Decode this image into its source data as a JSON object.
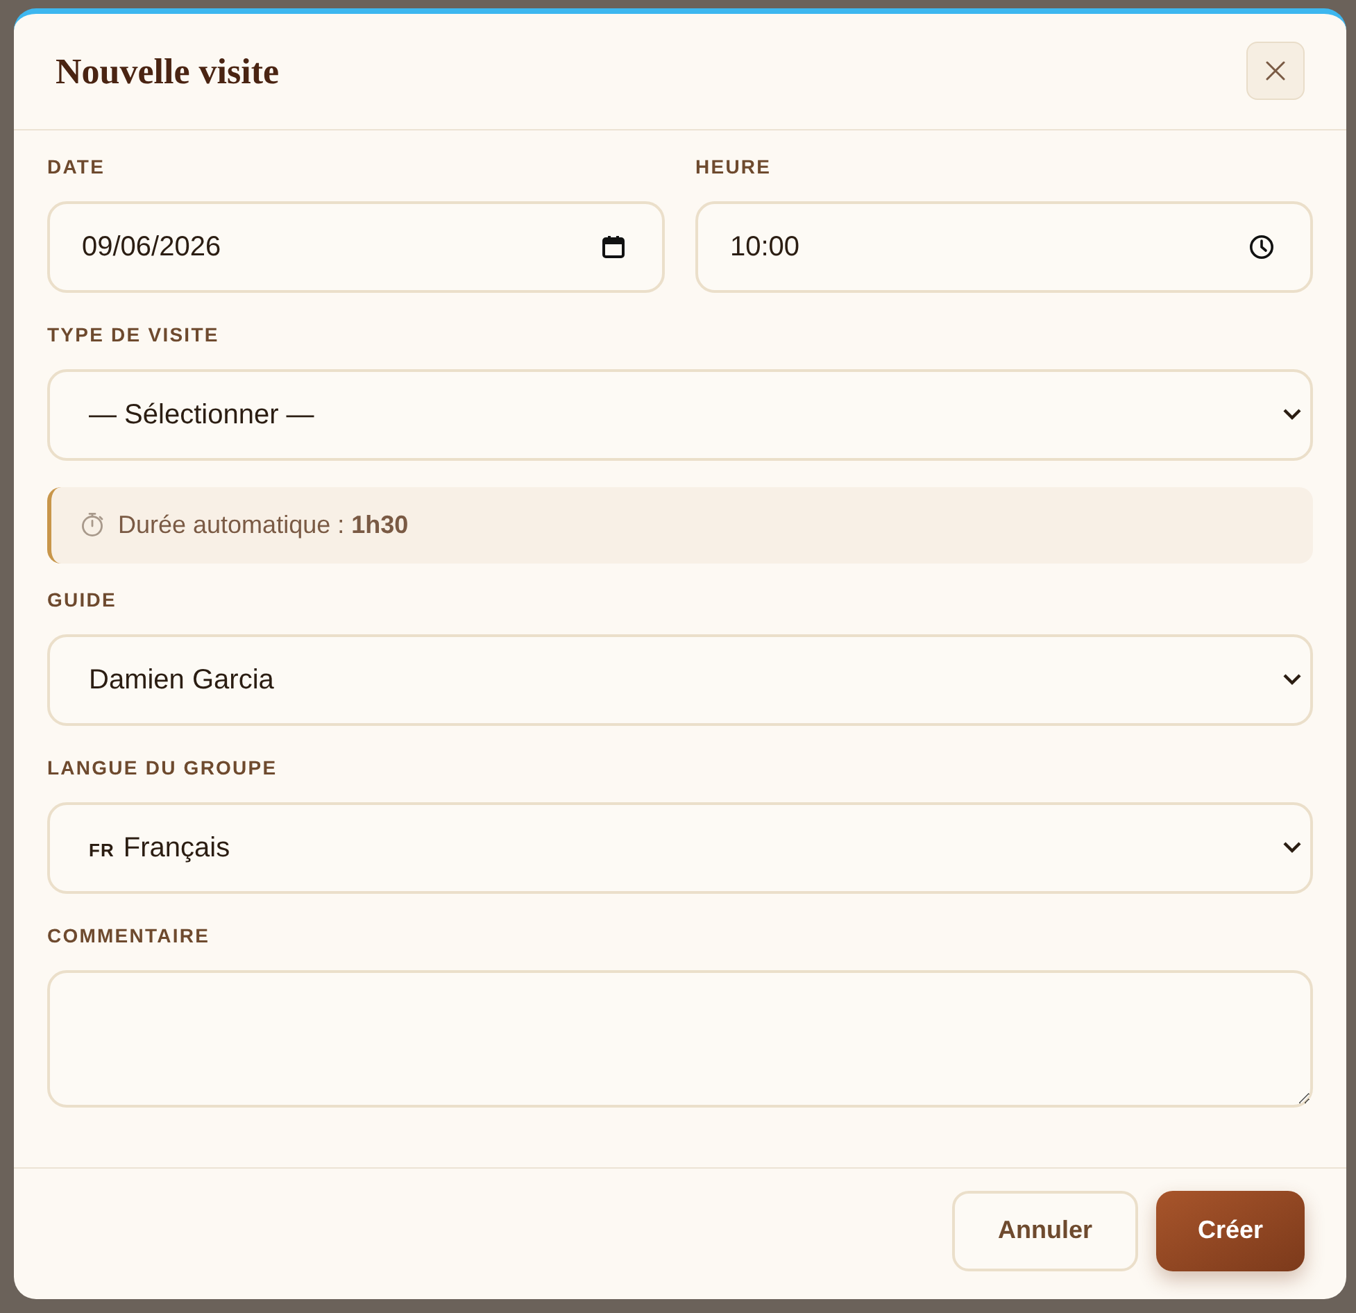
{
  "dialog": {
    "title": "Nouvelle visite"
  },
  "schedule": [
    {
      "kind": "date",
      "label": "DATE",
      "value": "09/06/2026"
    },
    {
      "kind": "time",
      "label": "HEURE",
      "value": "10:00"
    }
  ],
  "fields": [
    {
      "kind": "select",
      "label": "TYPE DE VISITE",
      "value": "— Sélectionner —"
    },
    {
      "kind": "notice",
      "text": "Durée automatique : **1h30**"
    },
    {
      "kind": "select",
      "label": "GUIDE",
      "value": "Damien Garcia"
    },
    {
      "kind": "select",
      "label": "LANGUE DU GROUPE",
      "prefix": "FR",
      "value": "Français"
    },
    {
      "kind": "textarea",
      "label": "COMMENTAIRE"
    }
  ],
  "buttons": [
    {
      "kind": "secondary",
      "label": "Annuler"
    },
    {
      "kind": "primary",
      "label": "Créer"
    }
  ]
}
